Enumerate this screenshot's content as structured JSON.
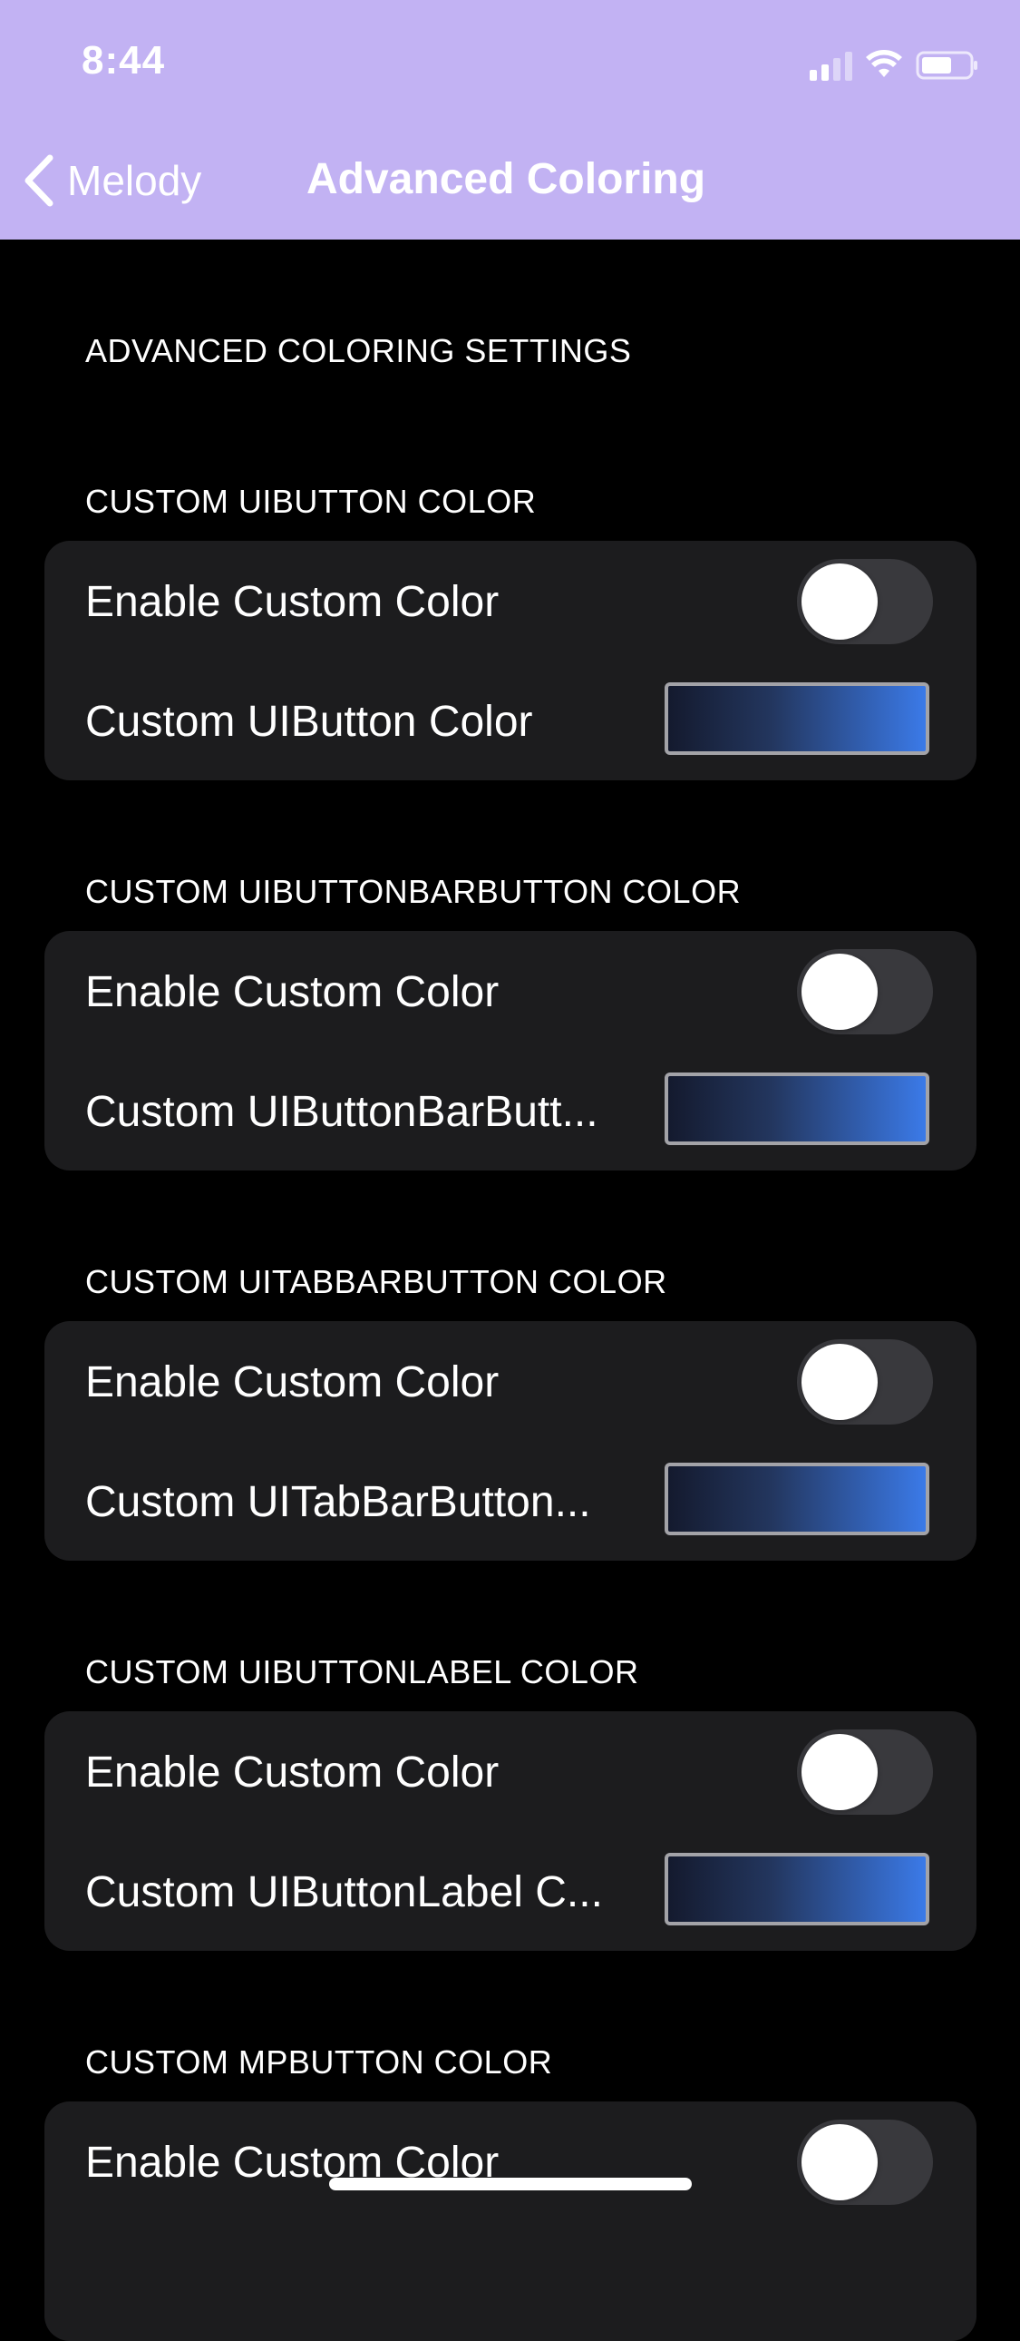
{
  "status_bar": {
    "time": "8:44",
    "icons": [
      "signal-icon",
      "wifi-icon",
      "battery-icon"
    ]
  },
  "nav": {
    "back_label": "Melody",
    "title": "Advanced Coloring",
    "background": "#c2b2f3"
  },
  "page": {
    "heading": "ADVANCED COLORING SETTINGS"
  },
  "groups": [
    {
      "header": "CUSTOM UIBUTTON COLOR",
      "toggle_label": "Enable Custom Color",
      "toggle_on": false,
      "color_label": "Custom UIButton Color"
    },
    {
      "header": "CUSTOM UIBUTTONBARBUTTON COLOR",
      "toggle_label": "Enable Custom Color",
      "toggle_on": false,
      "color_label": "Custom UIButtonBarButt..."
    },
    {
      "header": "CUSTOM UITABBARBUTTON COLOR",
      "toggle_label": "Enable Custom Color",
      "toggle_on": false,
      "color_label": "Custom UITabBarButton..."
    },
    {
      "header": "CUSTOM UIBUTTONLABEL COLOR",
      "toggle_label": "Enable Custom Color",
      "toggle_on": false,
      "color_label": "Custom UIButtonLabel C..."
    },
    {
      "header": "CUSTOM MPBUTTON COLOR",
      "toggle_label": "Enable Custom Color",
      "toggle_on": false
    }
  ],
  "colors": {
    "swatch_gradient_start": "#141a2e",
    "swatch_gradient_end": "#3b7ae8",
    "group_background": "#1c1c1e",
    "toggle_off": "#39393d"
  }
}
